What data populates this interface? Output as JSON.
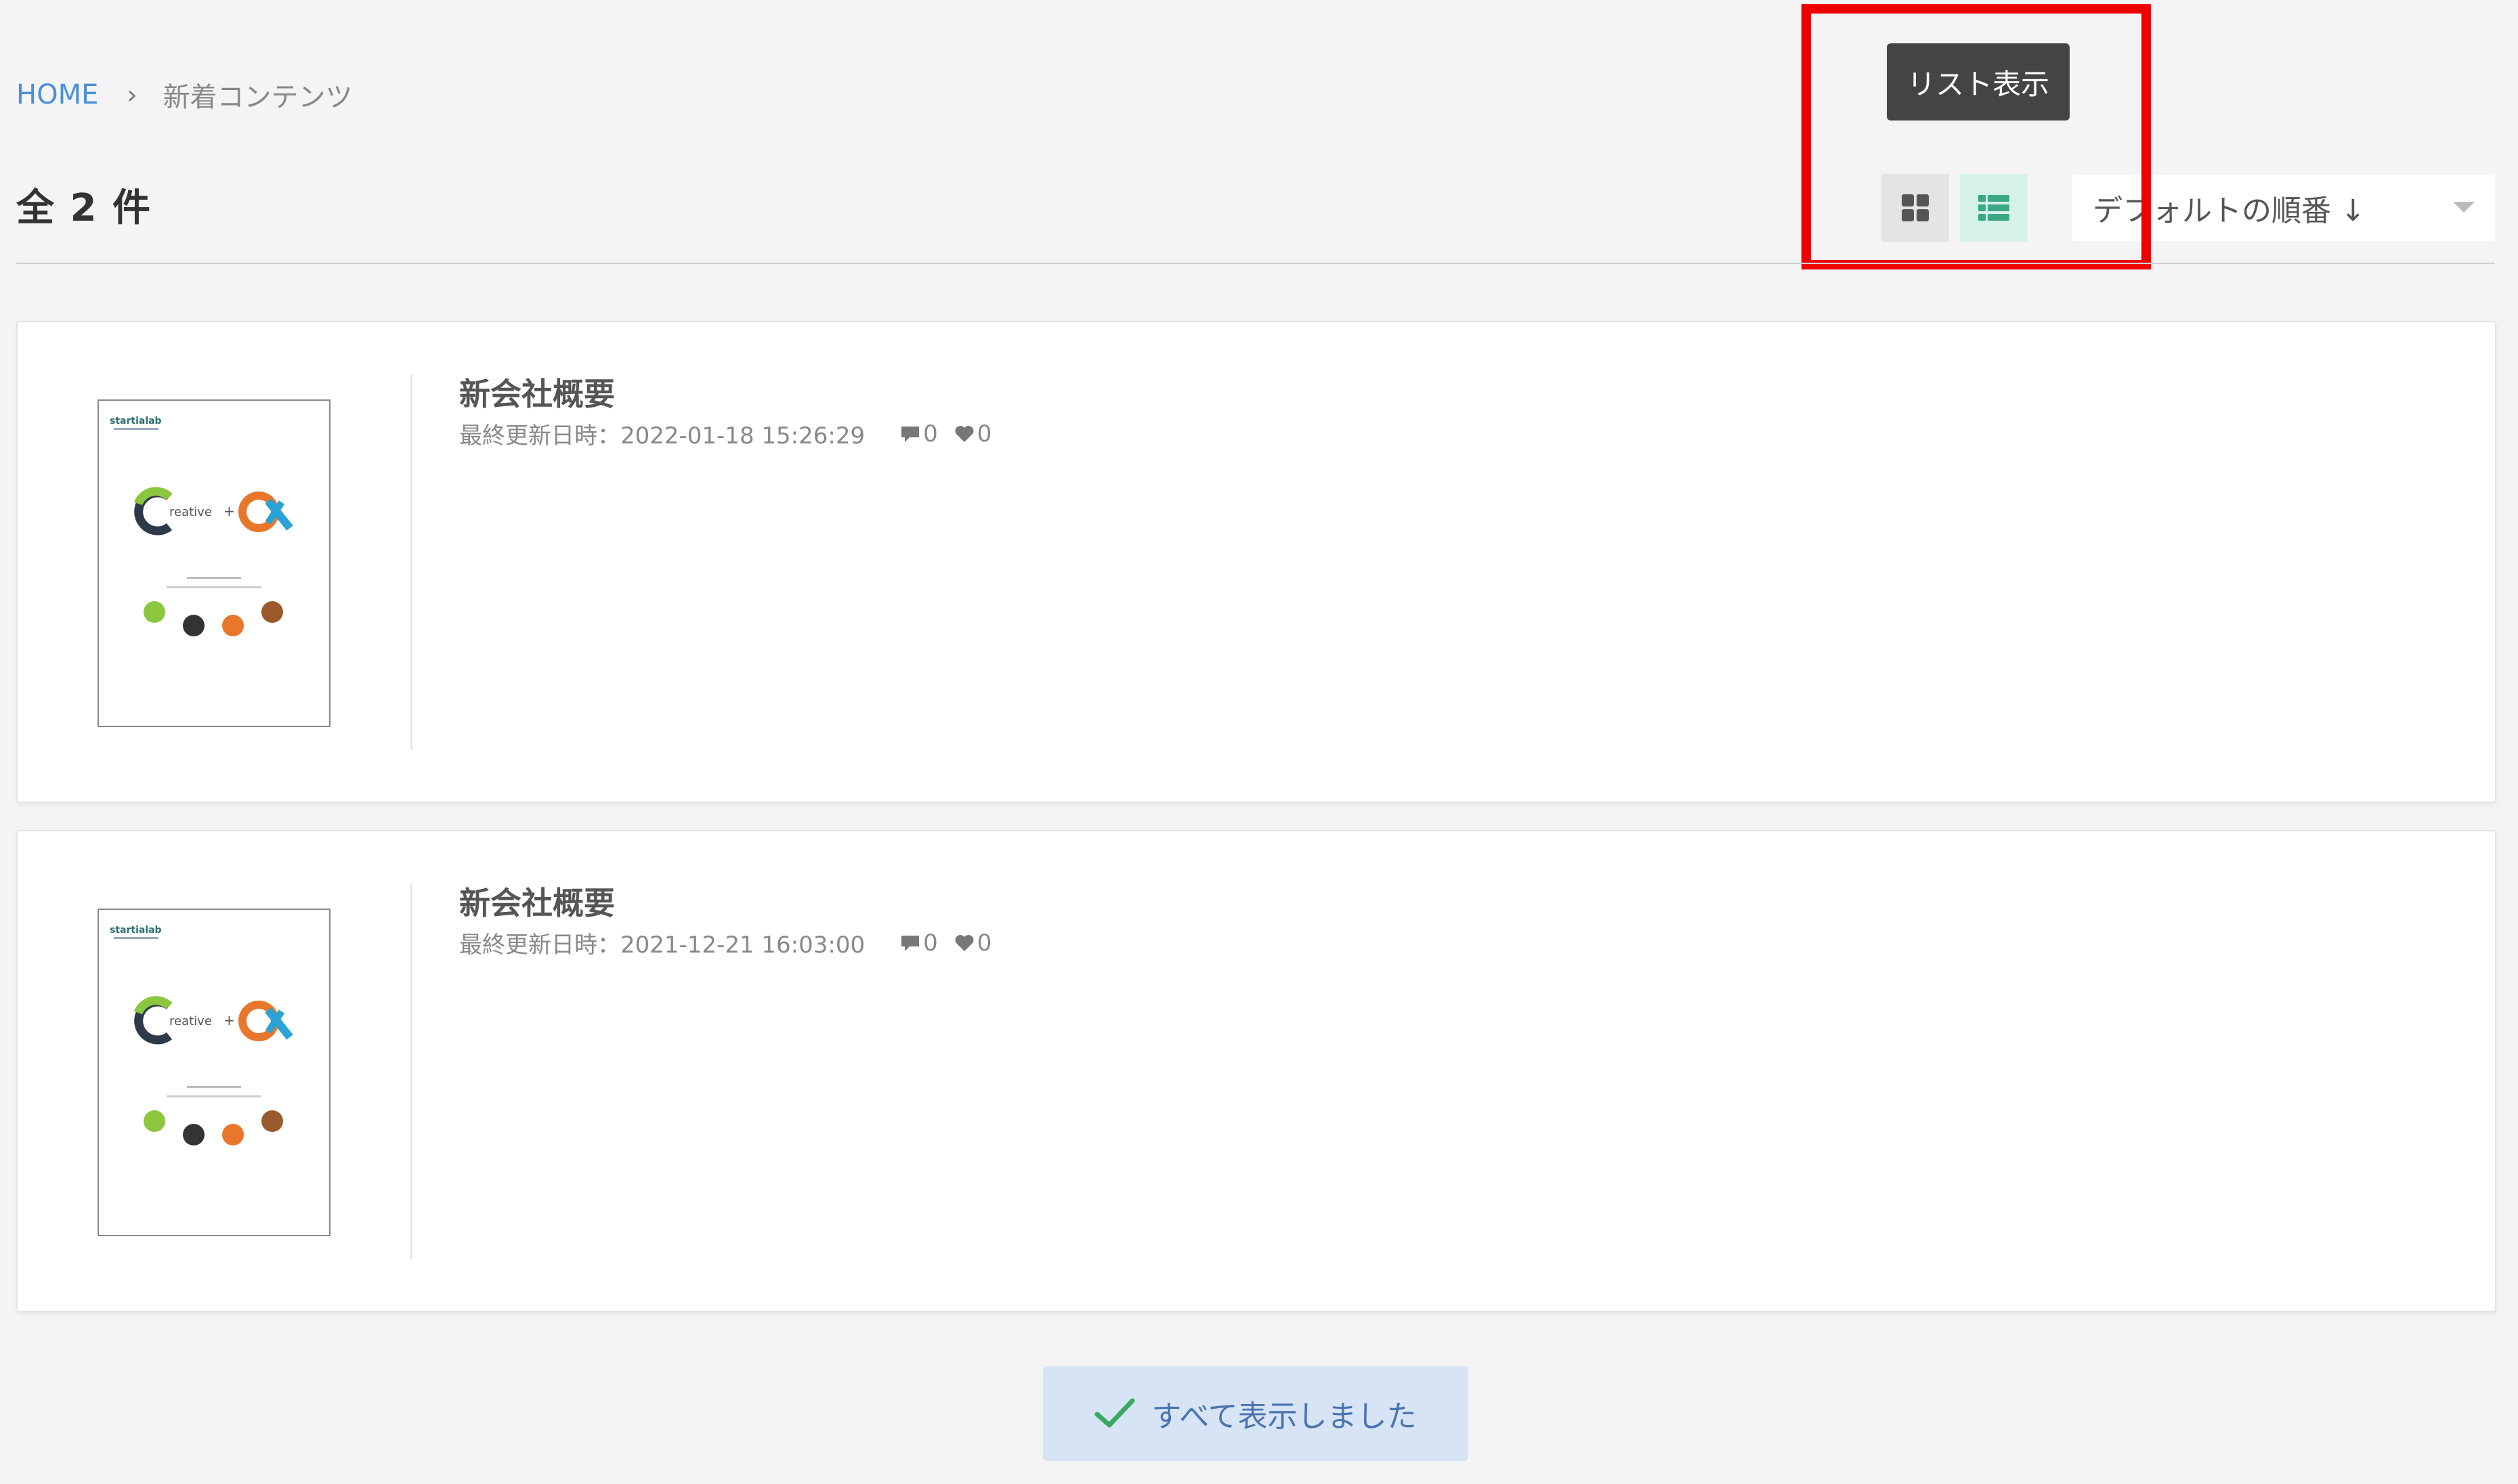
{
  "breadcrumb": {
    "home": "HOME",
    "separator": "›",
    "current": "新着コンテンツ"
  },
  "summary": {
    "total_label": "全 2 件"
  },
  "toolbar": {
    "tooltip": "リスト表示",
    "grid_view_icon": "grid-icon",
    "list_view_icon": "list-icon",
    "selected_view": "list",
    "sort_label": "デフォルトの順番 ↓"
  },
  "items": [
    {
      "title": "新会社概要",
      "updated": "最終更新日時：2022-01-18 15:26:29",
      "comments": "0",
      "likes": "0"
    },
    {
      "title": "新会社概要",
      "updated": "最終更新日時：2021-12-21 16:03:00",
      "comments": "0",
      "likes": "0"
    }
  ],
  "thumbnail": {
    "logo": "startialab",
    "headline_left": "reative",
    "headline_plus": "+"
  },
  "footer": {
    "all_shown_label": "すべて表示しました"
  },
  "colors": {
    "accent_link": "#4a8fd8",
    "highlight": "#ee0000",
    "list_active": "#3aa886",
    "done_text": "#4a74b0",
    "done_check": "#3aa860"
  }
}
